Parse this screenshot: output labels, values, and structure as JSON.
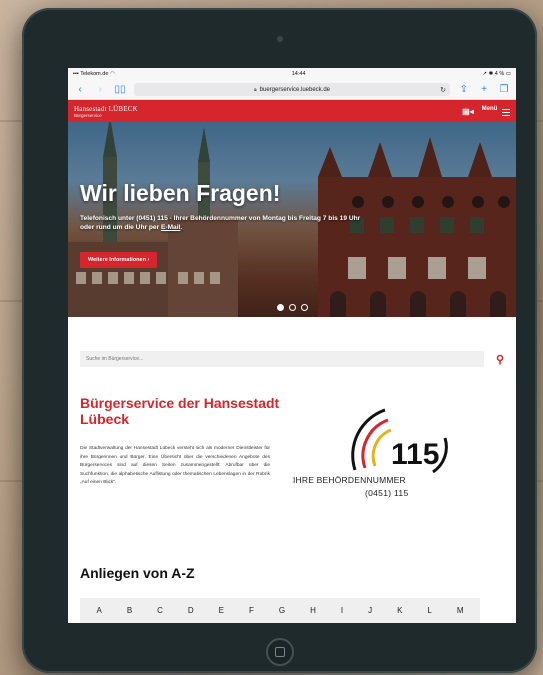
{
  "status_bar": {
    "carrier": "Telekom.de",
    "time": "14:44",
    "battery": "4 %"
  },
  "browser": {
    "url": "buergerservice.luebeck.de"
  },
  "site_header": {
    "brand_name": "Hansestadt LÜBECK",
    "brand_sub": "Bürgerservice",
    "menu_label": "Menü"
  },
  "hero": {
    "title": "Wir lieben Fragen!",
    "text_before_link": "Telefonisch unter (0451) 115 - Ihrer Behördennummer von Montag bis Freitag 7 bis 19 Uhr oder rund um die Uhr per ",
    "link_text": "E-Mail",
    "text_after_link": ".",
    "button_label": "Weitere Informationen  ›",
    "slides": 3,
    "active_slide": 1
  },
  "search": {
    "placeholder": "Suche im Bürgerservice..."
  },
  "content": {
    "title": "Bürgerservice der Hansestadt Lübeck",
    "intro": "Die Stadtverwaltung der Hansestadt Lübeck versteht sich als moderner Dienstleister für ihre Bürgerinnen und Bürger. Eine Übersicht über die verschiedenen Angebote des Bürgerservices sind auf diesen Seiten zusammengestellt: Abrufbar über die Suchfunktion, die alphabetische Auflistung oder thematischen Lebenslagen in der Rubrik „Auf einen Blick“."
  },
  "badge": {
    "number": "115",
    "line1": "IHRE BEHÖRDENNUMMER",
    "line2": "(0451) 115"
  },
  "az": {
    "title": "Anliegen von A-Z",
    "letters": [
      "A",
      "B",
      "C",
      "D",
      "E",
      "F",
      "G",
      "H",
      "I",
      "J",
      "K",
      "L",
      "M"
    ]
  },
  "colors": {
    "brand_red": "#d4262c",
    "ios_blue": "#2f7cf6"
  }
}
